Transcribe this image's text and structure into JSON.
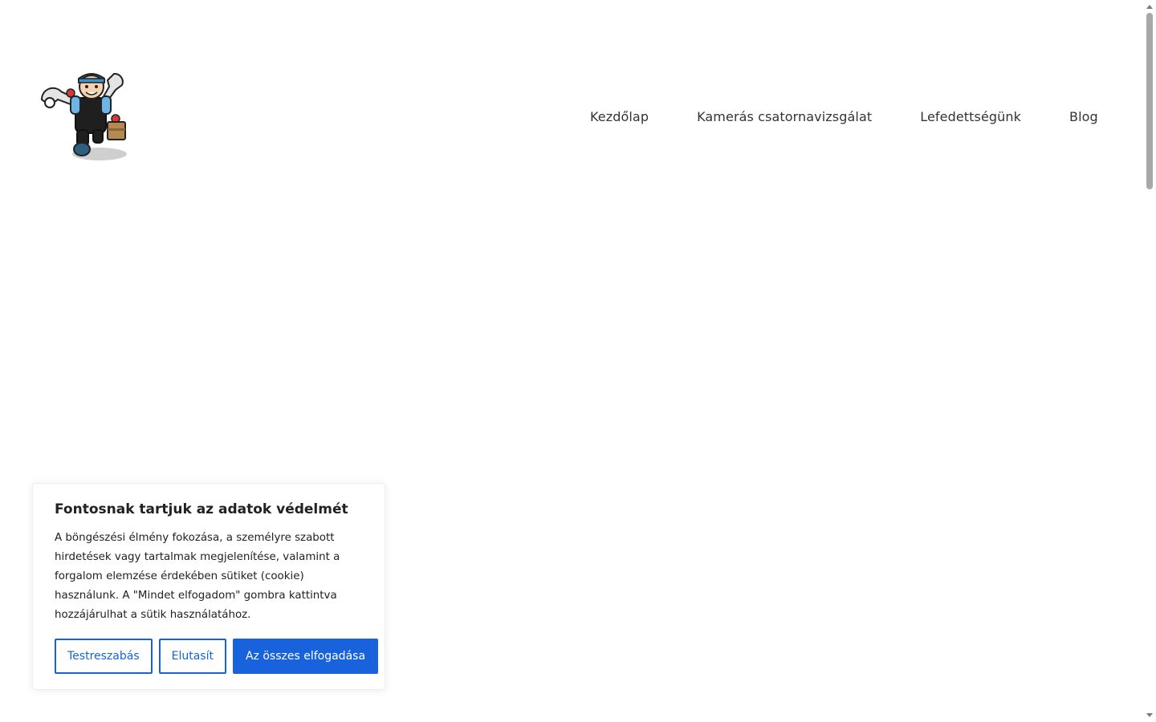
{
  "header": {
    "logo_icon": "plumber-mascot-icon",
    "nav": [
      {
        "label": "Kezdőlap"
      },
      {
        "label": "Kamerás csatornavizsgálat"
      },
      {
        "label": "Lefedettségünk"
      },
      {
        "label": "Blog"
      }
    ]
  },
  "cookie_banner": {
    "title": "Fontosnak tartjuk az adatok védelmét",
    "text": "A böngészési élmény fokozása, a személyre szabott hirdetések vagy tartalmak megjelenítése, valamint a forgalom elemzése érdekében sütiket (cookie) használunk. A \"Mindet elfogadom\" gombra kattintva hozzájárulhat a sütik használatához.",
    "customize_label": "Testreszabás",
    "reject_label": "Elutasít",
    "accept_all_label": "Az összes elfogadása",
    "accent_color": "#1863dc"
  }
}
